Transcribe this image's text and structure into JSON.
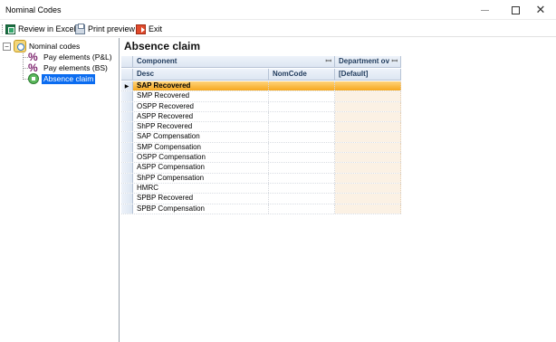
{
  "window": {
    "title": "Nominal Codes"
  },
  "toolbar": {
    "review_excel": "Review in Excel",
    "print_preview": "Print preview",
    "exit": "Exit"
  },
  "tree": {
    "root": "Nominal codes",
    "items": [
      {
        "label": "Pay elements (P&L)",
        "icon": "percent-icon"
      },
      {
        "label": "Pay elements (BS)",
        "icon": "percent-icon"
      },
      {
        "label": "Absence claim",
        "icon": "absence-icon",
        "selected": true
      }
    ]
  },
  "panel": {
    "title": "Absence claim",
    "group_headers": {
      "component": "Component",
      "department": "Department ov"
    },
    "columns": {
      "desc": "Desc",
      "nomcode": "NomCode",
      "department": "[Default]"
    },
    "rows": [
      {
        "desc": "SAP Recovered",
        "nomcode": "",
        "department": ""
      },
      {
        "desc": "SMP Recovered",
        "nomcode": "",
        "department": ""
      },
      {
        "desc": "OSPP Recovered",
        "nomcode": "",
        "department": ""
      },
      {
        "desc": "ASPP Recovered",
        "nomcode": "",
        "department": ""
      },
      {
        "desc": "ShPP Recovered",
        "nomcode": "",
        "department": ""
      },
      {
        "desc": "SAP Compensation",
        "nomcode": "",
        "department": ""
      },
      {
        "desc": "SMP Compensation",
        "nomcode": "",
        "department": ""
      },
      {
        "desc": "OSPP Compensation",
        "nomcode": "",
        "department": ""
      },
      {
        "desc": "ASPP Compensation",
        "nomcode": "",
        "department": ""
      },
      {
        "desc": "ShPP Compensation",
        "nomcode": "",
        "department": ""
      },
      {
        "desc": "HMRC",
        "nomcode": "",
        "department": ""
      },
      {
        "desc": "SPBP Recovered",
        "nomcode": "",
        "department": ""
      },
      {
        "desc": "SPBP Compensation",
        "nomcode": "",
        "department": ""
      }
    ]
  }
}
